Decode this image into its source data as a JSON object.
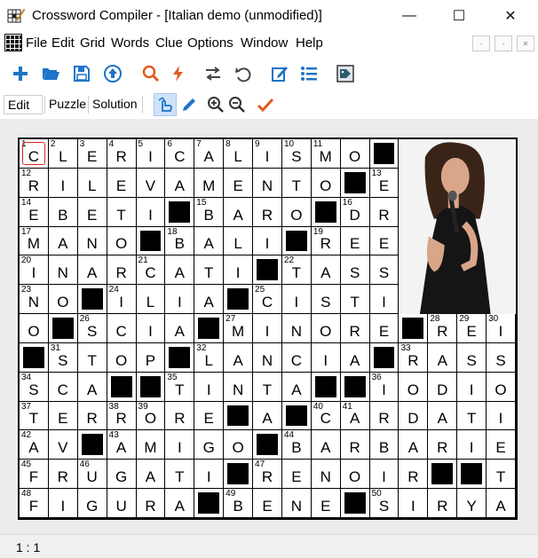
{
  "window": {
    "title": "Crossword Compiler - [Italian demo (unmodified)]",
    "minimize": "—",
    "maximize": "☐",
    "close": "✕"
  },
  "menu": [
    "File",
    "Edit",
    "Grid",
    "Words",
    "Clue",
    "Options",
    "Window",
    "Help"
  ],
  "mdi_controls": [
    "-",
    "▫",
    "✕"
  ],
  "toolbar": {
    "icons": [
      "add-icon",
      "open-folder-icon",
      "save-icon",
      "upload-icon",
      "search-icon",
      "autofill-icon",
      "swap-icon",
      "undo-icon",
      "edit-clue-icon",
      "list-icon",
      "tag-icon"
    ]
  },
  "tabs": [
    "Edit",
    "Puzzle",
    "Solution"
  ],
  "active_tab": "Edit",
  "colors": {
    "accent_blue": "#1e74c8",
    "accent_orange": "#e15a1f",
    "grid_black": "#000000",
    "cursor_red": "#e02020"
  },
  "grid": {
    "cols": 17,
    "rows": 13,
    "cursor_cell": "0,0",
    "image_area": "top-right 4×6 cells, photo of a woman singing into a microphone",
    "cells": [
      "C1 L2 E3 R4 I5 C6 A7 L8 I9 S10 M11 O # ~ ~ ~ ~",
      "R12 I L E V A M E N T O # E13 ~ ~ ~ ~",
      "E14 B E T I # B15 A R O # D16 R ~ ~ ~ ~",
      "M17 A N O # B18 A L I # R19 E E ~ ~ ~ ~",
      "I20 N A R C21 A T I # T22 A S S ~ ~ ~ ~",
      "N23 O # I24 L I A # C25 I S T I ~ ~ ~ ~",
      "O # S26 C I A # M27 I N O R E # R28 E29 I30",
      "# S31 T O P # L32 A N C I A # R33 A S S",
      "S34 C A # # T35 I N T A # # I36 O D I O",
      "T37 E R R38 O39 R E # A # C40 A41 R D A T I",
      "A42 V # A43 M I G O # B44 A R B A R I E",
      "F45 R U46 G A T I # R47 E N O I R # # T",
      "F48 I G U R A # B49 E N E # S50 I R Y A"
    ]
  },
  "status": "1 : 1"
}
